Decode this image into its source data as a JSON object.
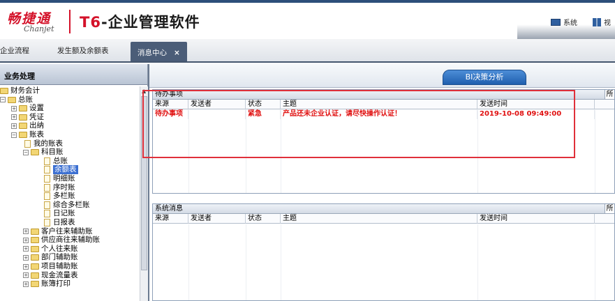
{
  "header": {
    "logo_cn": "畅捷通",
    "logo_en": "Chanjet",
    "product_prefix": "T6",
    "product_rest": "-企业管理软件",
    "system_label": "系统",
    "view_label": "视"
  },
  "tabs": [
    {
      "label": "企业流程"
    },
    {
      "label": "发生额及余额表"
    },
    {
      "label": "消息中心",
      "close": "×"
    }
  ],
  "left": {
    "title": "业务处理",
    "tree": [
      {
        "label": "财务会计",
        "type": "folder",
        "toggle": "",
        "level": 0
      },
      {
        "label": "总账",
        "type": "folder",
        "toggle": "−",
        "level": 1
      },
      {
        "label": "设置",
        "type": "folder",
        "toggle": "+",
        "level": 2
      },
      {
        "label": "凭证",
        "type": "folder",
        "toggle": "+",
        "level": 2
      },
      {
        "label": "出纳",
        "type": "folder",
        "toggle": "+",
        "level": 2
      },
      {
        "label": "账表",
        "type": "folder",
        "toggle": "−",
        "level": 2
      },
      {
        "label": "我的账表",
        "type": "doc",
        "toggle": "",
        "level": 3
      },
      {
        "label": "科目账",
        "type": "folder",
        "toggle": "−",
        "level": 3
      },
      {
        "label": "总账",
        "type": "doc",
        "toggle": "",
        "level": 4
      },
      {
        "label": "余额表",
        "type": "doc",
        "toggle": "",
        "level": 4,
        "selected": true
      },
      {
        "label": "明细账",
        "type": "doc",
        "toggle": "",
        "level": 4
      },
      {
        "label": "序时账",
        "type": "doc",
        "toggle": "",
        "level": 4
      },
      {
        "label": "多栏账",
        "type": "doc",
        "toggle": "",
        "level": 4
      },
      {
        "label": "综合多栏账",
        "type": "doc",
        "toggle": "",
        "level": 4
      },
      {
        "label": "日记账",
        "type": "doc",
        "toggle": "",
        "level": 4
      },
      {
        "label": "日报表",
        "type": "doc",
        "toggle": "",
        "level": 4
      },
      {
        "label": "客户往来辅助账",
        "type": "folder",
        "toggle": "+",
        "level": 3
      },
      {
        "label": "供应商往来辅助账",
        "type": "folder",
        "toggle": "+",
        "level": 3
      },
      {
        "label": "个人往来账",
        "type": "folder",
        "toggle": "+",
        "level": 3
      },
      {
        "label": "部门辅助账",
        "type": "folder",
        "toggle": "+",
        "level": 3
      },
      {
        "label": "项目辅助账",
        "type": "folder",
        "toggle": "+",
        "level": 3
      },
      {
        "label": "现金流量表",
        "type": "folder",
        "toggle": "+",
        "level": 3
      },
      {
        "label": "账簿打印",
        "type": "folder",
        "toggle": "+",
        "level": 3
      }
    ]
  },
  "right": {
    "bi_button": "BI决策分析",
    "pending": {
      "title": "待办事项",
      "right_label": "所",
      "columns": [
        "来源",
        "发送者",
        "状态",
        "主题",
        "发送时间"
      ],
      "rows": [
        {
          "source": "待办事项",
          "sender": "",
          "status": "紧急",
          "subject": "产品还未企业认证，请尽快操作认证！",
          "time": "2019-10-08 09:49:00"
        }
      ]
    },
    "system": {
      "title": "系统消息",
      "right_label": "所",
      "columns": [
        "来源",
        "发送者",
        "状态",
        "主题",
        "发送时间"
      ],
      "rows": []
    }
  }
}
